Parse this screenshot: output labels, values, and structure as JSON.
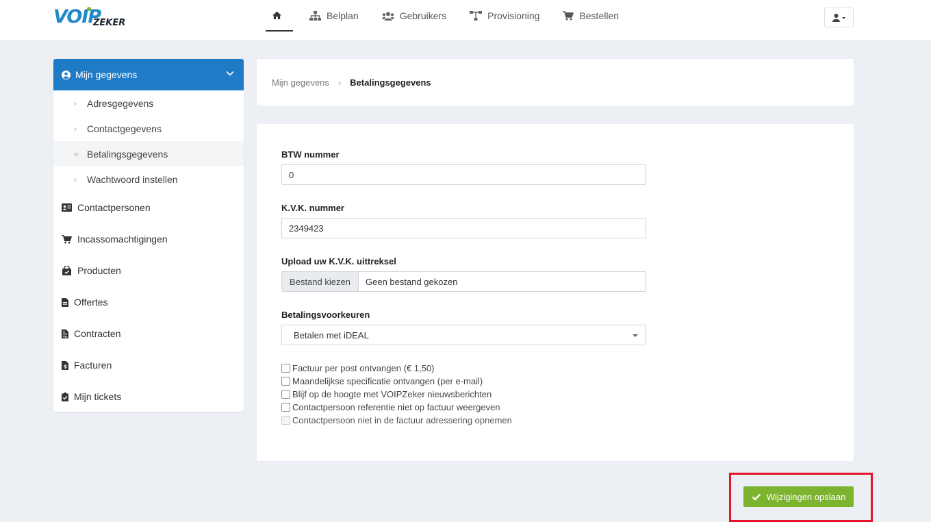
{
  "brand": {
    "logo_main": "VOIP",
    "logo_sub": "ZEKER",
    "primary_color": "#1f7bc6",
    "accent_color": "#7cb42f",
    "highlight_color": "#e5142a"
  },
  "nav": {
    "items": [
      {
        "label": "",
        "icon": "home-icon",
        "active": true
      },
      {
        "label": "Belplan",
        "icon": "sitemap-icon"
      },
      {
        "label": "Gebruikers",
        "icon": "users-icon"
      },
      {
        "label": "Provisioning",
        "icon": "network-icon"
      },
      {
        "label": "Bestellen",
        "icon": "cart-icon"
      }
    ],
    "user_menu_icon": "user-icon"
  },
  "sidebar": {
    "header": {
      "label": "Mijn gegevens",
      "icon": "user-circle-icon",
      "expanded": true
    },
    "sub_items": [
      {
        "label": "Adresgegevens"
      },
      {
        "label": "Contactgegevens"
      },
      {
        "label": "Betalingsgegevens",
        "active": true
      },
      {
        "label": "Wachtwoord instellen"
      }
    ],
    "items": [
      {
        "label": "Contactpersonen",
        "icon": "id-card-icon"
      },
      {
        "label": "Incassomachtigingen",
        "icon": "cart-icon"
      },
      {
        "label": "Producten",
        "icon": "shopping-bag-icon"
      },
      {
        "label": "Offertes",
        "icon": "file-icon"
      },
      {
        "label": "Contracten",
        "icon": "file-contract-icon"
      },
      {
        "label": "Facturen",
        "icon": "invoice-icon"
      },
      {
        "label": "Mijn tickets",
        "icon": "clipboard-check-icon"
      }
    ]
  },
  "breadcrumb": {
    "parent": "Mijn gegevens",
    "current": "Betalingsgegevens"
  },
  "form": {
    "btw": {
      "label": "BTW nummer",
      "value": "0"
    },
    "kvk": {
      "label": "K.V.K. nummer",
      "value": "2349423"
    },
    "upload": {
      "label": "Upload uw K.V.K. uittreksel",
      "button": "Bestand kiezen",
      "status": "Geen bestand gekozen"
    },
    "payment": {
      "label": "Betalingsvoorkeuren",
      "selected": "Betalen met iDEAL"
    },
    "checkboxes": [
      {
        "label": "Factuur per post ontvangen (€ 1,50)",
        "checked": false
      },
      {
        "label": "Maandelijkse specificatie ontvangen (per e-mail)",
        "checked": false
      },
      {
        "label": "Blijf op de hoogte met VOIPZeker nieuwsberichten",
        "checked": false
      },
      {
        "label": "Contactpersoon referentie niet op factuur weergeven",
        "checked": false
      },
      {
        "label": "Contactpersoon niet in de factuur adressering opnemen",
        "checked": false,
        "disabled": true
      }
    ]
  },
  "save_button": {
    "label": "Wijzigingen opslaan",
    "icon": "check-icon"
  }
}
